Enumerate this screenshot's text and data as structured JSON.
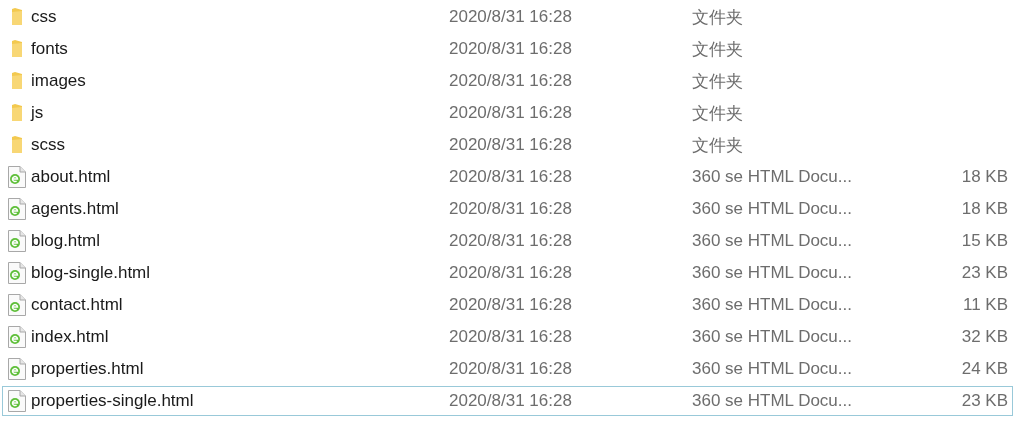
{
  "files": [
    {
      "kind": "folder",
      "name": "css",
      "date": "2020/8/31 16:28",
      "type": "文件夹",
      "focused": false
    },
    {
      "kind": "folder",
      "name": "fonts",
      "date": "2020/8/31 16:28",
      "type": "文件夹",
      "focused": false
    },
    {
      "kind": "folder",
      "name": "images",
      "date": "2020/8/31 16:28",
      "type": "文件夹",
      "focused": false
    },
    {
      "kind": "folder",
      "name": "js",
      "date": "2020/8/31 16:28",
      "type": "文件夹",
      "focused": false
    },
    {
      "kind": "folder",
      "name": "scss",
      "date": "2020/8/31 16:28",
      "type": "文件夹",
      "focused": false
    },
    {
      "kind": "html",
      "name": "about.html",
      "date": "2020/8/31 16:28",
      "type": "360 se HTML Docu...",
      "size": "18 KB",
      "focused": false
    },
    {
      "kind": "html",
      "name": "agents.html",
      "date": "2020/8/31 16:28",
      "type": "360 se HTML Docu...",
      "size": "18 KB",
      "focused": false
    },
    {
      "kind": "html",
      "name": "blog.html",
      "date": "2020/8/31 16:28",
      "type": "360 se HTML Docu...",
      "size": "15 KB",
      "focused": false
    },
    {
      "kind": "html",
      "name": "blog-single.html",
      "date": "2020/8/31 16:28",
      "type": "360 se HTML Docu...",
      "size": "23 KB",
      "focused": false
    },
    {
      "kind": "html",
      "name": "contact.html",
      "date": "2020/8/31 16:28",
      "type": "360 se HTML Docu...",
      "size": "11 KB",
      "focused": false
    },
    {
      "kind": "html",
      "name": "index.html",
      "date": "2020/8/31 16:28",
      "type": "360 se HTML Docu...",
      "size": "32 KB",
      "focused": false
    },
    {
      "kind": "html",
      "name": "properties.html",
      "date": "2020/8/31 16:28",
      "type": "360 se HTML Docu...",
      "size": "24 KB",
      "focused": false
    },
    {
      "kind": "html",
      "name": "properties-single.html",
      "date": "2020/8/31 16:28",
      "type": "360 se HTML Docu...",
      "size": "23 KB",
      "focused": true
    }
  ]
}
